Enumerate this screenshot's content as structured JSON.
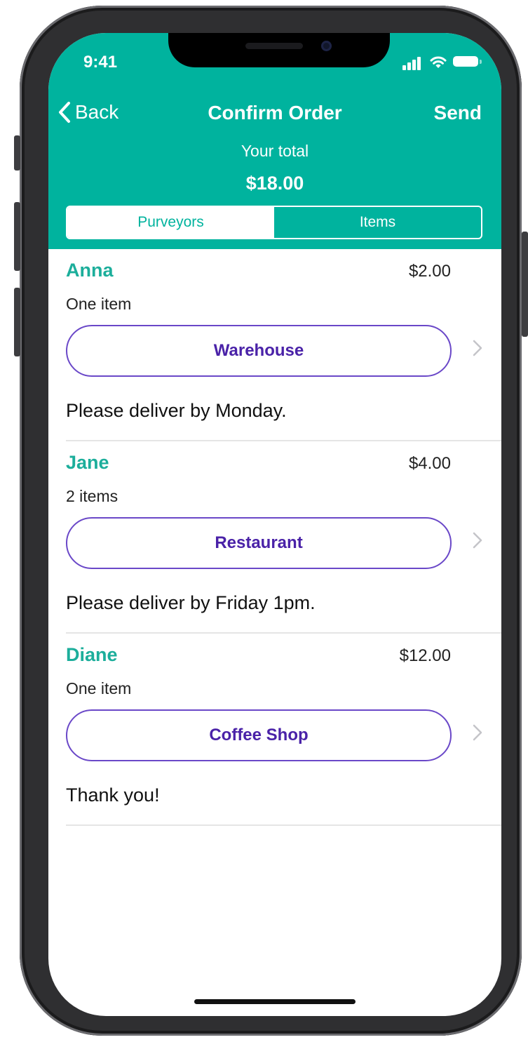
{
  "status": {
    "time": "9:41"
  },
  "nav": {
    "back_label": "Back",
    "title": "Confirm Order",
    "send_label": "Send"
  },
  "summary": {
    "total_label": "Your total",
    "total_value": "$18.00"
  },
  "segments": [
    {
      "label": "Purveyors",
      "selected": true
    },
    {
      "label": "Items",
      "selected": false
    }
  ],
  "orders": [
    {
      "name": "Anna",
      "price": "$2.00",
      "count": "One item",
      "location": "Warehouse",
      "note": "Please deliver by Monday."
    },
    {
      "name": "Jane",
      "price": "$4.00",
      "count": "2 items",
      "location": "Restaurant",
      "note": "Please deliver by Friday 1pm."
    },
    {
      "name": "Diane",
      "price": "$12.00",
      "count": "One item",
      "location": "Coffee Shop",
      "note": "Thank you!"
    }
  ],
  "colors": {
    "brand_teal": "#00b39e",
    "accent_purple": "#6a48c8"
  },
  "icons": {
    "back": "chevron-left-icon",
    "row": "chevron-right-icon",
    "signal": "cellular-signal-icon",
    "wifi": "wifi-icon",
    "battery": "battery-icon"
  }
}
